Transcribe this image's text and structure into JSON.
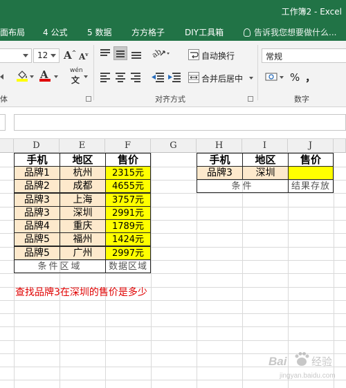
{
  "window": {
    "title": "工作簿2 - Excel"
  },
  "menu": {
    "tabs": [
      "面布局",
      "4 公式",
      "5 数据",
      "方方格子",
      "DIY工具箱"
    ],
    "tell_me": "告诉我您想要做什么..."
  },
  "ribbon": {
    "font_size": "12",
    "number_format": "常规",
    "wrap_text_label": "自动换行",
    "merge_center_label": "合并后居中",
    "percent_symbol": "%",
    "comma_symbol": "，",
    "font_group_label": "体",
    "alignment_group_label": "对齐方式",
    "number_group_label": "数字",
    "phonetic_label": "wén"
  },
  "grid": {
    "columns": [
      "D",
      "E",
      "F",
      "G",
      "H",
      "I",
      "J"
    ],
    "headers": {
      "phone": "手机",
      "region": "地区",
      "price": "售价"
    },
    "rows": [
      {
        "brand": "品牌1",
        "city": "杭州",
        "price": "2315元"
      },
      {
        "brand": "品牌2",
        "city": "成都",
        "price": "4655元"
      },
      {
        "brand": "品牌3",
        "city": "上海",
        "price": "3757元"
      },
      {
        "brand": "品牌3",
        "city": "深圳",
        "price": "2991元"
      },
      {
        "brand": "品牌4",
        "city": "重庆",
        "price": "1789元"
      },
      {
        "brand": "品牌5",
        "city": "福州",
        "price": "1424元"
      },
      {
        "brand": "品牌5",
        "city": "广州",
        "price": "2997元"
      }
    ],
    "condition_area_label": "条件区域",
    "data_area_label": "数据区域",
    "lookup": {
      "brand": "品牌3",
      "city": "深圳",
      "result": "",
      "condition_label": "条件",
      "result_label": "结果存放"
    },
    "question": "查找品牌3在深圳的售价是多少"
  },
  "watermark": {
    "text": "Bai 经验",
    "subtext": "jingyan.baidu.com"
  },
  "colors": {
    "excel_green": "#217346",
    "cream": "#fde9cc",
    "highlight": "#ffff00",
    "question_red": "#e00000"
  }
}
